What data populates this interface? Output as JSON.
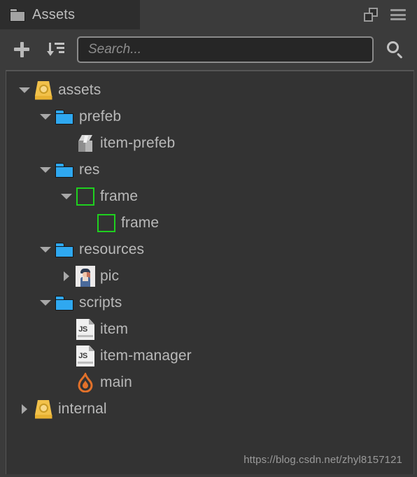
{
  "window": {
    "background_color": "#3b3b3b",
    "panel_color": "#333333"
  },
  "tab": {
    "label": "Assets",
    "icon": "folder-icon"
  },
  "tabbar_actions": [
    {
      "name": "popout-icon",
      "label": "Pop out panel"
    },
    {
      "name": "hamburger-menu-icon",
      "label": "Panel menu"
    }
  ],
  "toolbar": {
    "add_label": "+",
    "add_icon": "plus-icon",
    "sort_icon": "sort-descending-icon",
    "search_icon": "search-icon"
  },
  "search": {
    "value": "",
    "placeholder": "Search..."
  },
  "tree": {
    "items": [
      {
        "label": "assets",
        "depth": 0,
        "twisty": "open",
        "icon": "assets-db-icon"
      },
      {
        "label": "prefeb",
        "depth": 1,
        "twisty": "open",
        "icon": "folder-blue-icon"
      },
      {
        "label": "item-prefeb",
        "depth": 2,
        "twisty": "none",
        "icon": "prefab-cube-icon"
      },
      {
        "label": "res",
        "depth": 1,
        "twisty": "open",
        "icon": "folder-blue-icon"
      },
      {
        "label": "frame",
        "depth": 2,
        "twisty": "open",
        "icon": "sprite-frame-icon"
      },
      {
        "label": "frame",
        "depth": 3,
        "twisty": "none",
        "icon": "sprite-frame-icon"
      },
      {
        "label": "resources",
        "depth": 1,
        "twisty": "open",
        "icon": "folder-blue-icon"
      },
      {
        "label": "pic",
        "depth": 2,
        "twisty": "closed",
        "icon": "image-thumbnail-icon"
      },
      {
        "label": "scripts",
        "depth": 1,
        "twisty": "open",
        "icon": "folder-blue-icon"
      },
      {
        "label": "item",
        "depth": 2,
        "twisty": "none",
        "icon": "js-file-icon"
      },
      {
        "label": "item-manager",
        "depth": 2,
        "twisty": "none",
        "icon": "js-file-icon"
      },
      {
        "label": "main",
        "depth": 2,
        "twisty": "none",
        "icon": "flame-icon"
      },
      {
        "label": "internal",
        "depth": 0,
        "twisty": "closed",
        "icon": "assets-db-icon"
      }
    ]
  },
  "icon_text": {
    "js": "JS"
  },
  "watermark": {
    "text": "https://blog.csdn.net/zhyl8157121"
  },
  "colors": {
    "folder_blue": "#2fa8f0",
    "assets_gold": "#f2c14a",
    "frame_green": "#1fd01f",
    "flame_orange": "#e2712a",
    "text": "#b9b9b9"
  }
}
